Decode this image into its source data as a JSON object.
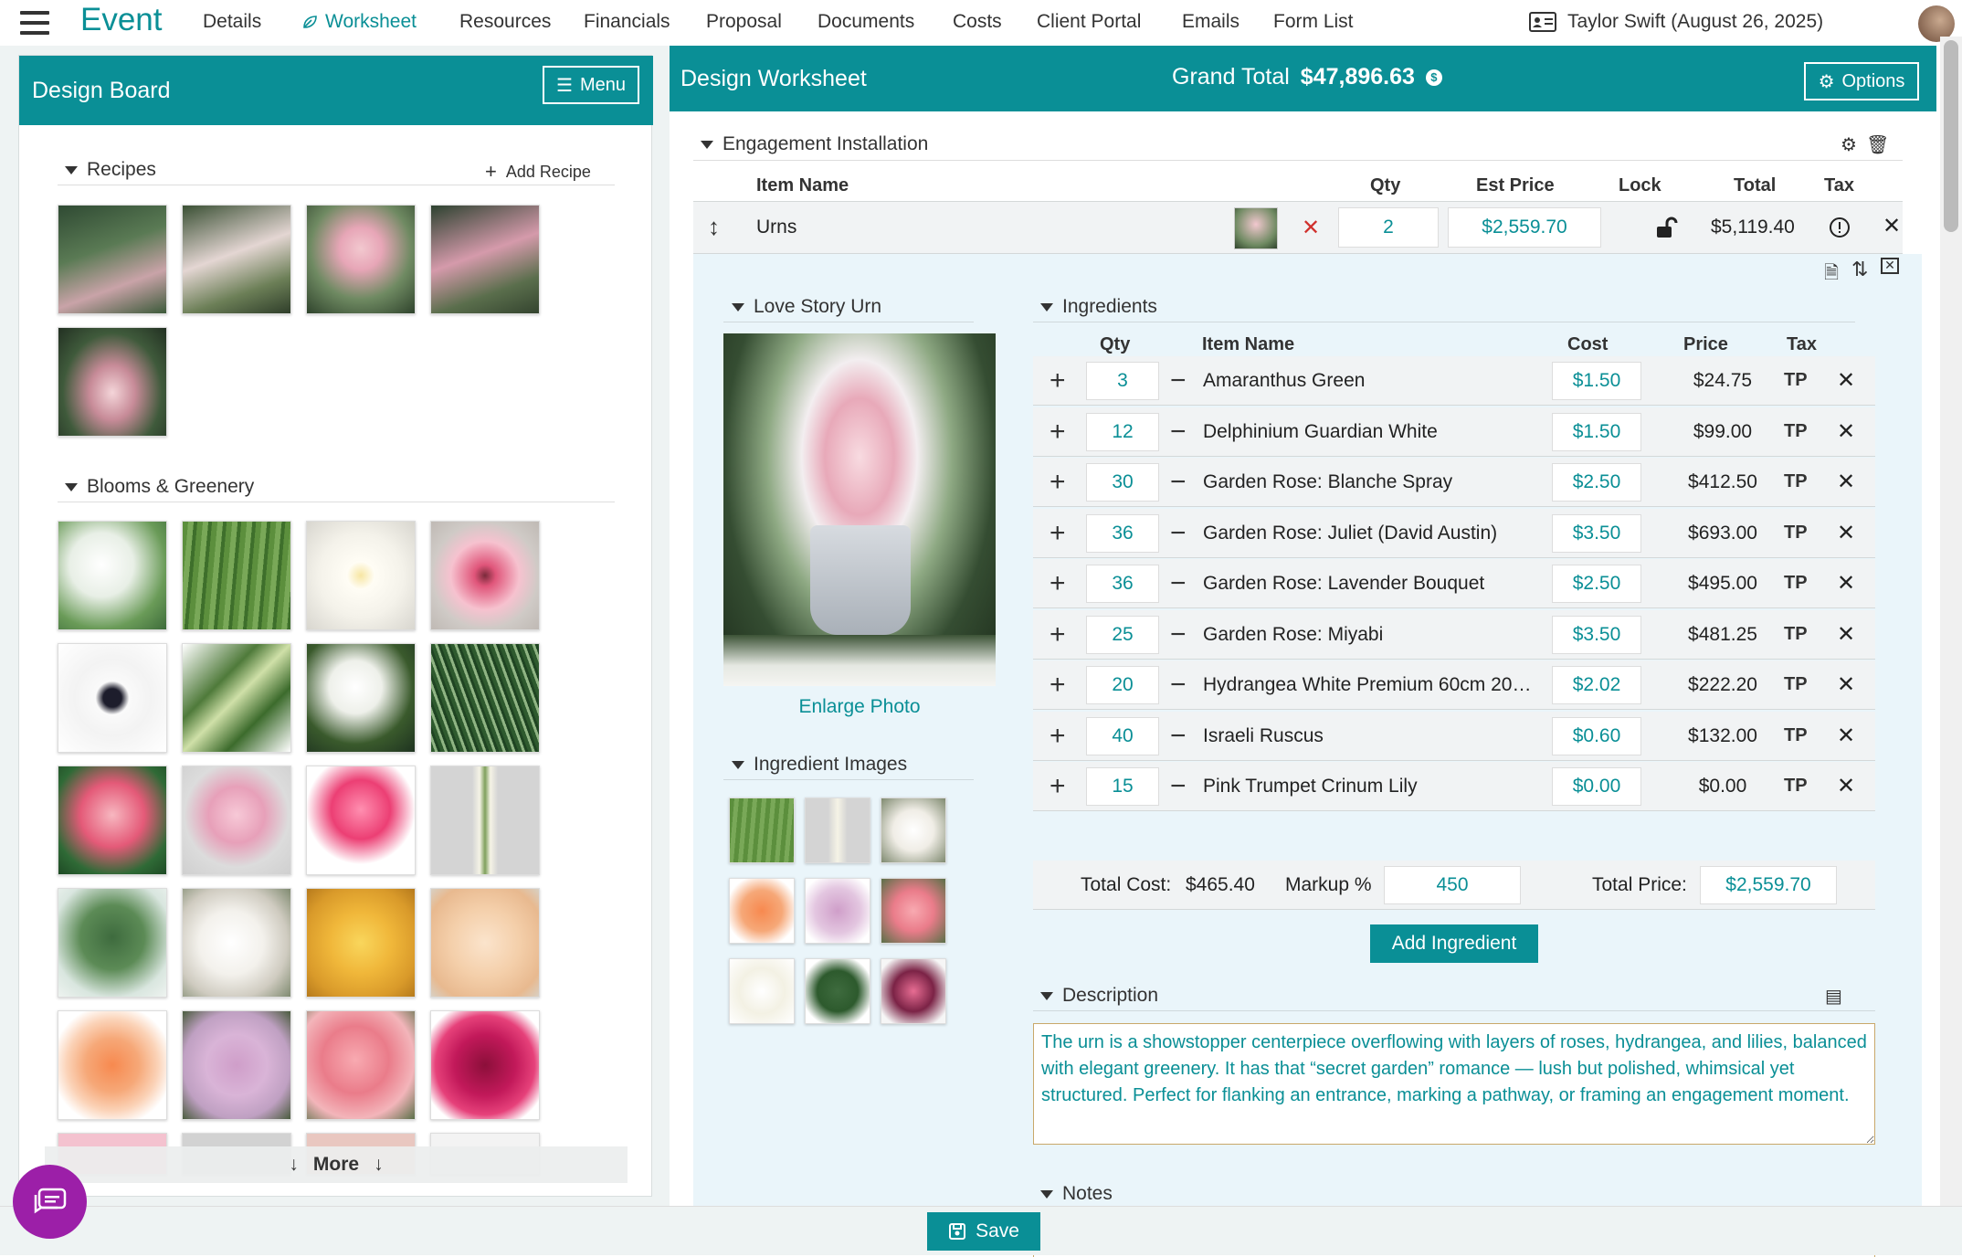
{
  "nav": {
    "brand": "Event",
    "links": [
      "Details",
      "Worksheet",
      "Resources",
      "Financials",
      "Proposal",
      "Documents",
      "Costs",
      "Client Portal",
      "Emails",
      "Form List"
    ],
    "active": "Worksheet",
    "client": "Taylor Swift (August 26, 2025)"
  },
  "design_board": {
    "title": "Design Board",
    "menu_label": "Menu",
    "recipes_label": "Recipes",
    "add_recipe_label": "Add Recipe",
    "blooms_label": "Blooms & Greenery",
    "more_label": "More"
  },
  "worksheet": {
    "title": "Design Worksheet",
    "grand_total_label": "Grand Total",
    "grand_total_value": "$47,896.63",
    "options_label": "Options",
    "section_title": "Engagement Installation",
    "columns": {
      "item_name": "Item Name",
      "qty": "Qty",
      "est_price": "Est Price",
      "lock": "Lock",
      "total": "Total",
      "tax": "Tax"
    },
    "item": {
      "name": "Urns",
      "qty": "2",
      "est_price": "$2,559.70",
      "total": "$5,119.40"
    }
  },
  "recipe": {
    "title": "Love Story Urn",
    "enlarge_label": "Enlarge Photo",
    "ingredient_images_label": "Ingredient Images"
  },
  "ingredients": {
    "title": "Ingredients",
    "columns": {
      "qty": "Qty",
      "item_name": "Item Name",
      "cost": "Cost",
      "price": "Price",
      "tax": "Tax"
    },
    "rows": [
      {
        "qty": "3",
        "name": "Amaranthus Green",
        "cost": "$1.50",
        "price": "$24.75",
        "tax": "TP"
      },
      {
        "qty": "12",
        "name": "Delphinium Guardian White",
        "cost": "$1.50",
        "price": "$99.00",
        "tax": "TP"
      },
      {
        "qty": "30",
        "name": "Garden Rose: Blanche Spray",
        "cost": "$2.50",
        "price": "$412.50",
        "tax": "TP"
      },
      {
        "qty": "36",
        "name": "Garden Rose: Juliet (David Austin)",
        "cost": "$3.50",
        "price": "$693.00",
        "tax": "TP"
      },
      {
        "qty": "36",
        "name": "Garden Rose: Lavender Bouquet",
        "cost": "$2.50",
        "price": "$495.00",
        "tax": "TP"
      },
      {
        "qty": "25",
        "name": "Garden Rose: Miyabi",
        "cost": "$3.50",
        "price": "$481.25",
        "tax": "TP"
      },
      {
        "qty": "20",
        "name": "Hydrangea White Premium 60cm 20c...",
        "cost": "$2.02",
        "price": "$222.20",
        "tax": "TP"
      },
      {
        "qty": "40",
        "name": "Israeli Ruscus",
        "cost": "$0.60",
        "price": "$132.00",
        "tax": "TP"
      },
      {
        "qty": "15",
        "name": "Pink Trumpet Crinum Lily",
        "cost": "$0.00",
        "price": "$0.00",
        "tax": "TP"
      }
    ],
    "total_cost_label": "Total Cost:",
    "total_cost_value": "$465.40",
    "markup_label": "Markup %",
    "markup_value": "450",
    "total_price_label": "Total Price:",
    "total_price_value": "$2,559.70",
    "add_label": "Add Ingredient"
  },
  "description": {
    "label": "Description",
    "text": "The urn is a showstopper centerpiece overflowing with layers of roses, hydrangea, and lilies, balanced with elegant greenery. It has that “secret garden” romance — lush but polished, whimsical yet structured. Perfect for flanking an entrance, marking a pathway, or framing an engagement moment."
  },
  "notes": {
    "label": "Notes"
  },
  "footer": {
    "save_label": "Save"
  },
  "colors": {
    "accent": "#0a8f96",
    "chat": "#9c1fa8",
    "delete_x": "#d0312d"
  }
}
